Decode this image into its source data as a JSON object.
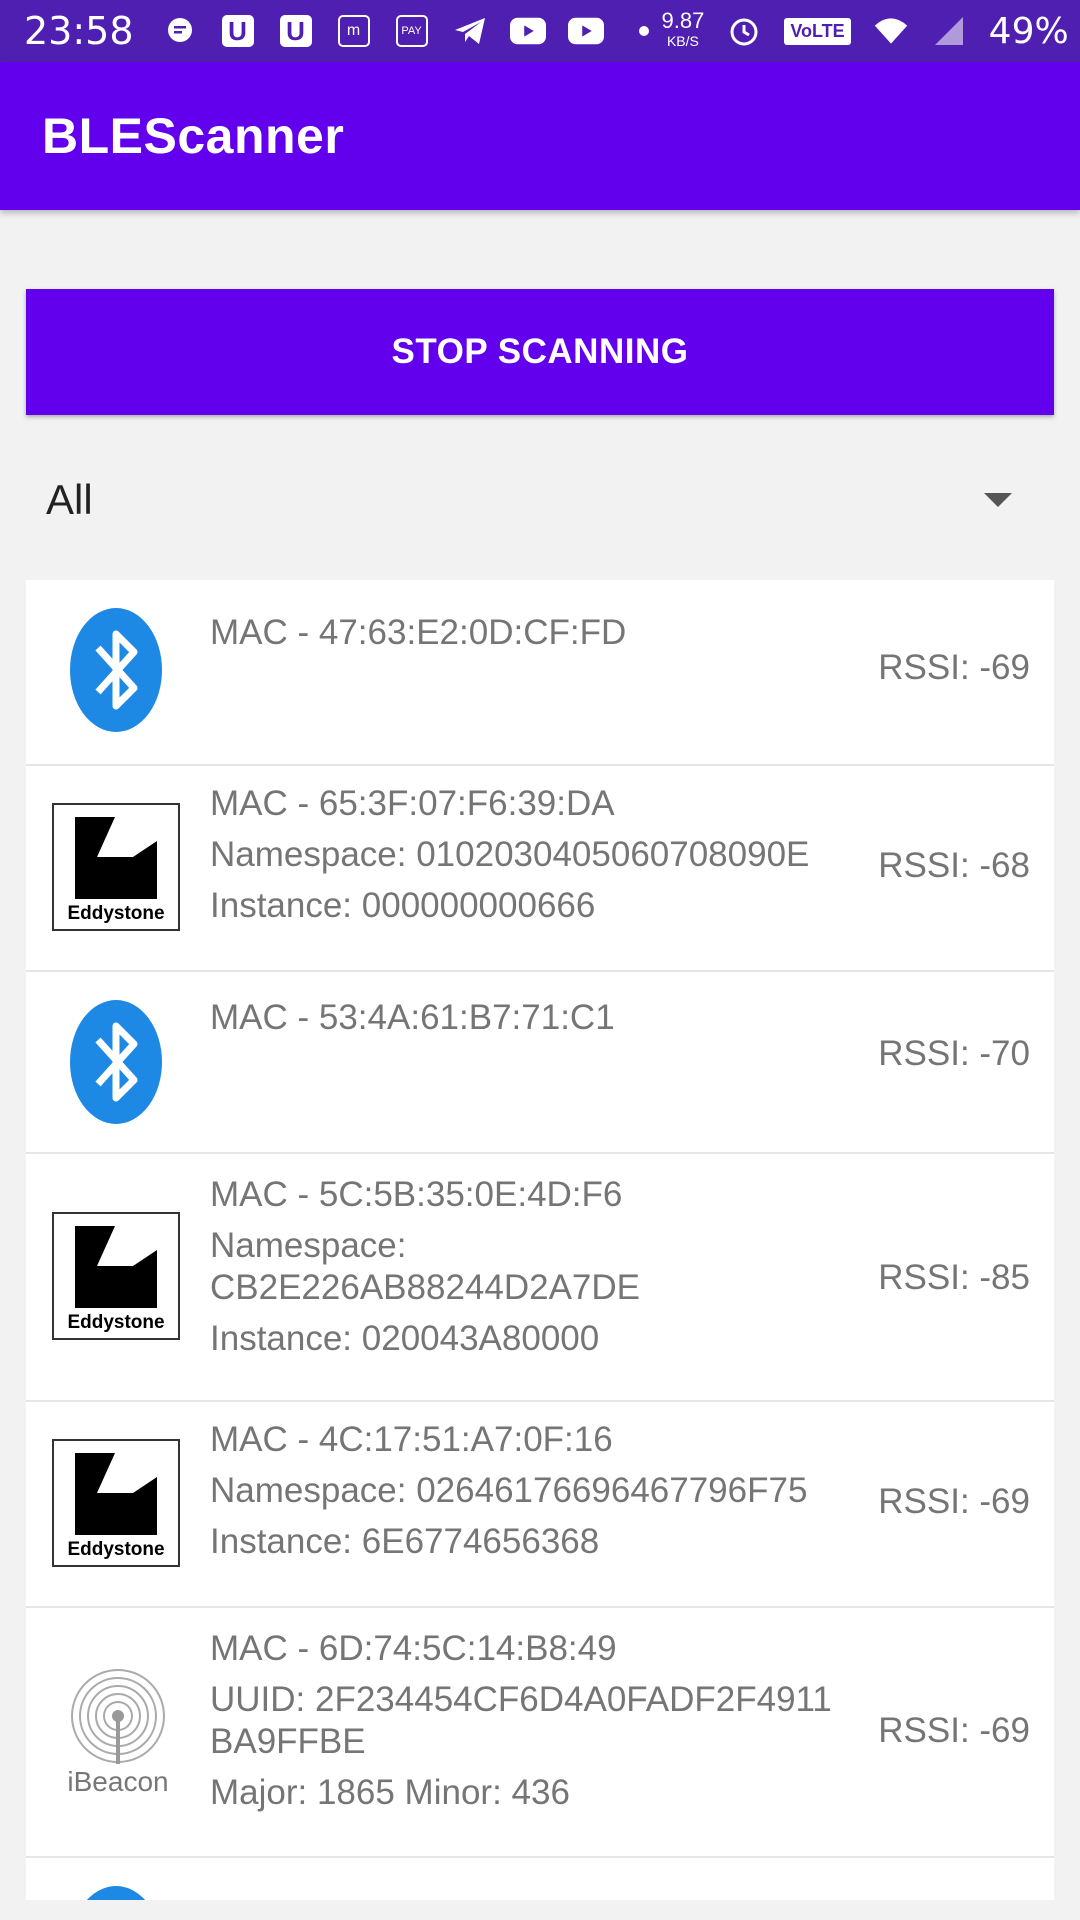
{
  "status_bar": {
    "time": "23:58",
    "speed_value": "9.87",
    "speed_unit": "KB/S",
    "volte": "VoLTE",
    "battery": "49%"
  },
  "app_bar": {
    "title": "BLEScanner"
  },
  "controls": {
    "stop_button_label": "STOP SCANNING",
    "filter_selected": "All"
  },
  "devices": [
    {
      "type": "bluetooth-icon",
      "lines": [
        "MAC - 47:63:E2:0D:CF:FD"
      ],
      "rssi": "RSSI: -69"
    },
    {
      "type": "eddystone-icon",
      "icon_label": "Eddystone",
      "lines": [
        "MAC - 65:3F:07:F6:39:DA",
        "Namespace: 0102030405060708090E",
        "Instance: 000000000666"
      ],
      "rssi": "RSSI: -68"
    },
    {
      "type": "bluetooth-icon",
      "lines": [
        "MAC - 53:4A:61:B7:71:C1"
      ],
      "rssi": "RSSI: -70"
    },
    {
      "type": "eddystone-icon",
      "icon_label": "Eddystone",
      "lines": [
        "MAC - 5C:5B:35:0E:4D:F6",
        "Namespace:",
        "CB2E226AB88244D2A7DE",
        "Instance: 020043A80000"
      ],
      "rssi": "RSSI: -85"
    },
    {
      "type": "eddystone-icon",
      "icon_label": "Eddystone",
      "lines": [
        "MAC - 4C:17:51:A7:0F:16",
        "Namespace: 02646176696467796F75",
        "Instance: 6E6774656368"
      ],
      "rssi": "RSSI: -69"
    },
    {
      "type": "ibeacon-icon",
      "icon_label": "iBeacon",
      "lines": [
        "MAC - 6D:74:5C:14:B8:49",
        "UUID: 2F234454CF6D4A0FADF2F4911",
        "BA9FFBE",
        "Major: 1865 Minor: 436"
      ],
      "rssi": "RSSI: -69"
    }
  ],
  "colors": {
    "status_bar": "#4e1fb0",
    "primary": "#6200ee",
    "bluetooth_blue": "#1e88e5",
    "secondary_text": "#757575"
  }
}
